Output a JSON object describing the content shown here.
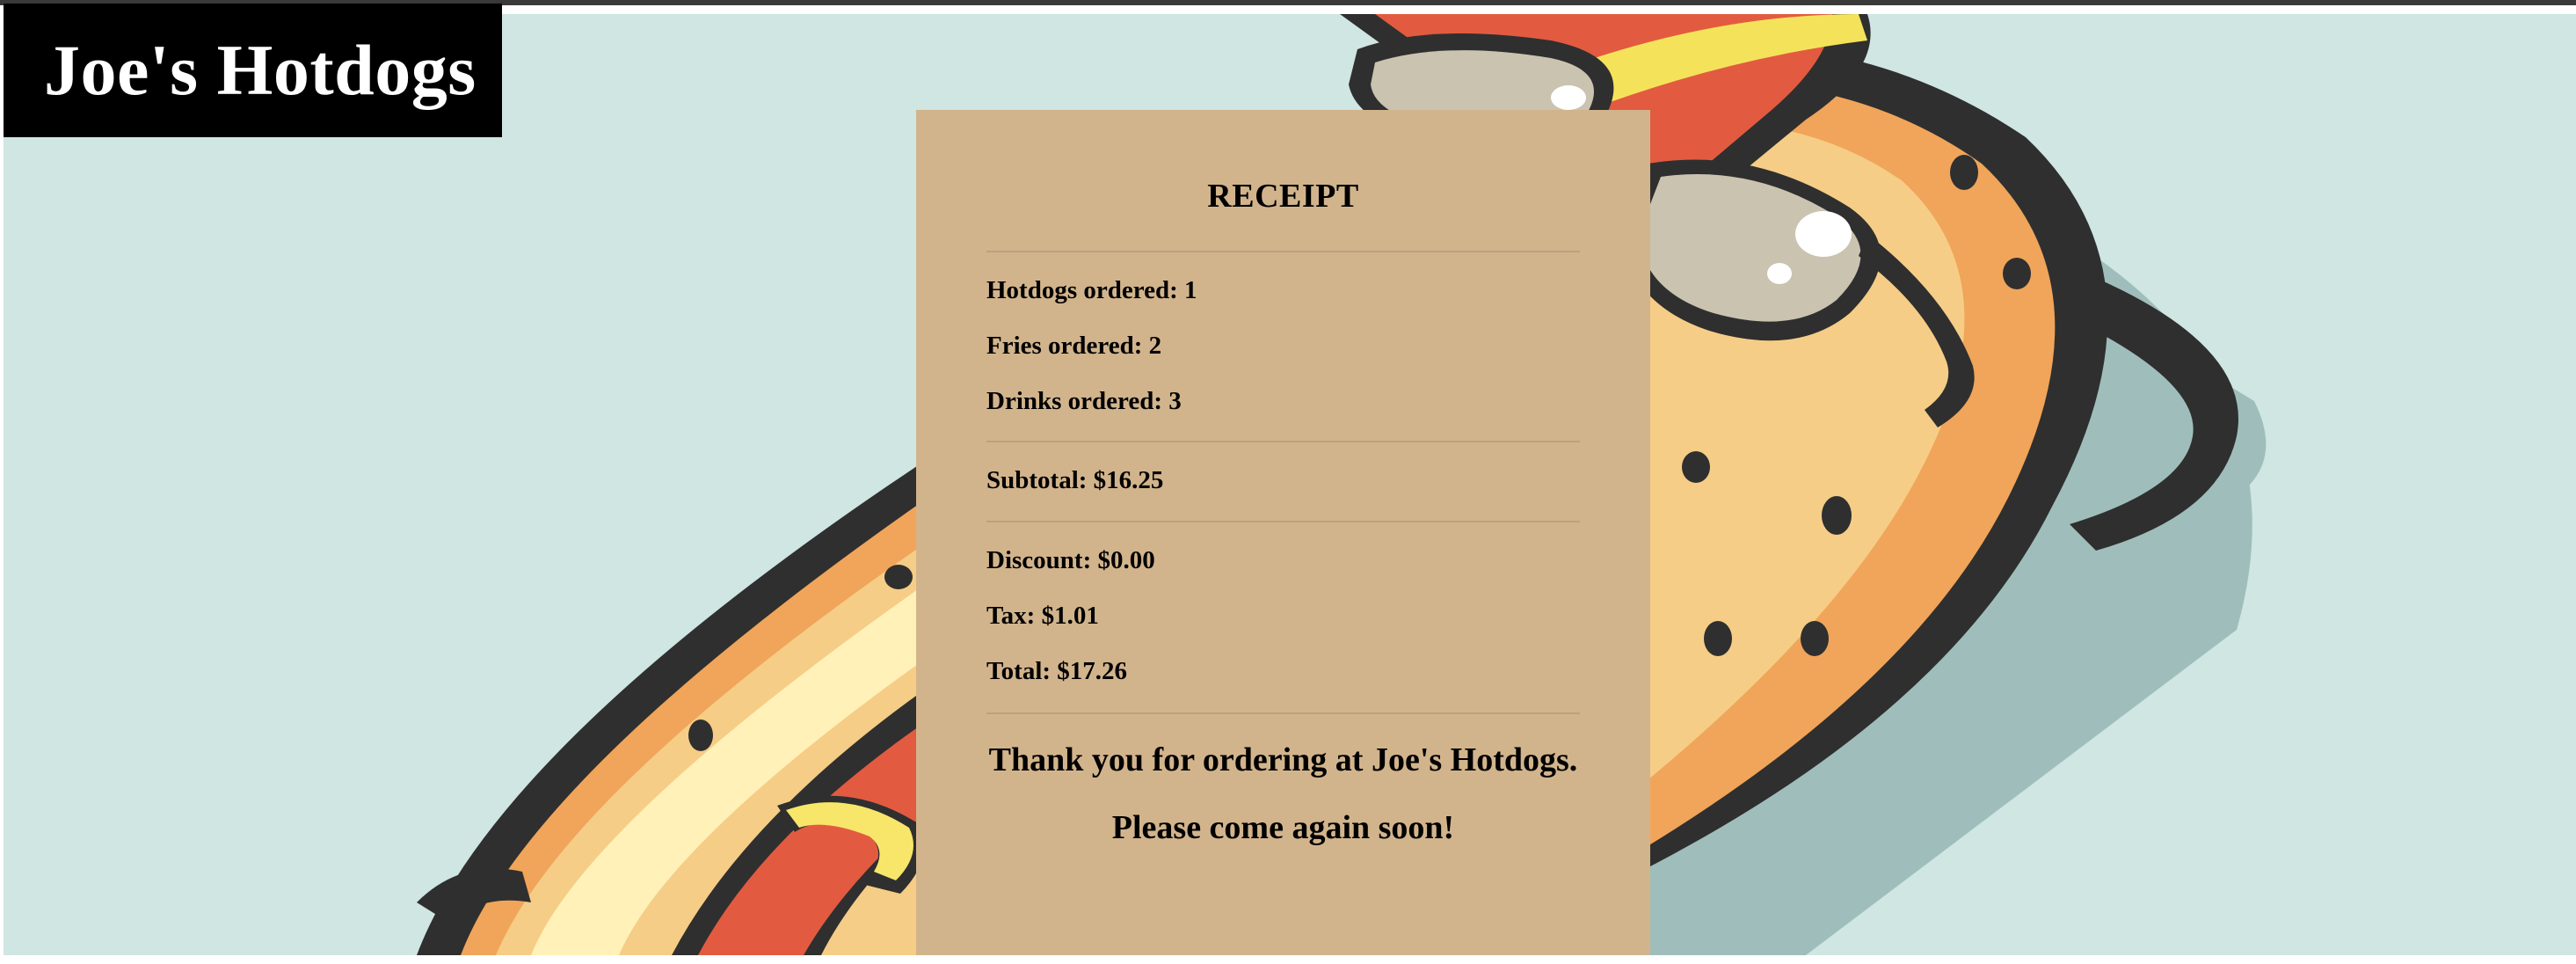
{
  "header": {
    "brand_title": "Joe's Hotdogs"
  },
  "hero": {
    "background_color": "#cfe6e3",
    "illustration": "hotdog-with-sunglasses"
  },
  "receipt": {
    "title": "RECEIPT",
    "background_color": "#d2b48c",
    "hotdogs_line": "Hotdogs ordered: 1",
    "fries_line": "Fries ordered: 2",
    "drinks_line": "Drinks ordered: 3",
    "subtotal_line": "Subtotal: $16.25",
    "discount_line": "Discount: $0.00",
    "tax_line": "Tax: $1.01",
    "total_line": "Total: $17.26",
    "thank_you": "Thank you for ordering at Joe's Hotdogs.",
    "come_again": "Please come again soon!"
  }
}
